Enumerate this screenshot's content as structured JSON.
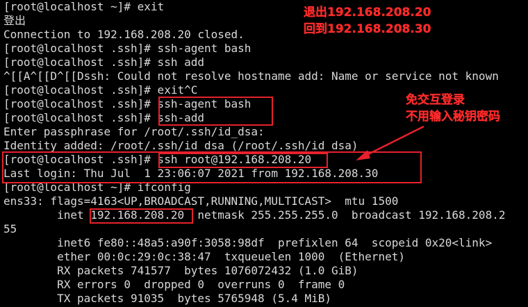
{
  "terminal": {
    "background": "#000000",
    "text_color": "#d9d9d9",
    "lines": [
      "[root@localhost ~]# exit",
      "登出",
      "Connection to 192.168.208.20 closed.",
      "[root@localhost .ssh]# ssh-agent bash",
      "[root@localhost .ssh]# ssh add",
      "^[[A^[[D^[[Dssh: Could not resolve hostname add: Name or service not known",
      "[root@localhost .ssh]# exit^C",
      "[root@localhost .ssh]# ssh-agent bash",
      "[root@localhost .ssh]# ssh-add",
      "Enter passphrase for /root/.ssh/id_dsa:",
      "Identity added: /root/.ssh/id_dsa (/root/.ssh/id_dsa)",
      "[root@localhost .ssh]# ssh root@192.168.208.20",
      "Last login: Thu Jul  1 23:06:07 2021 from 192.168.208.30",
      "[root@localhost ~]# ifconfig",
      "ens33: flags=4163<UP,BROADCAST,RUNNING,MULTICAST>  mtu 1500",
      "        inet 192.168.208.20  netmask 255.255.255.0  broadcast 192.168.208.2",
      "55",
      "        inet6 fe80::48a5:a90f:3058:98df  prefixlen 64  scopeid 0x20<link>",
      "        ether 00:0c:29:0c:38:47  txqueuelen 1000  (Ethernet)",
      "        RX packets 741577  bytes 1076072432 (1.0 GiB)",
      "        RX errors 0  dropped 0  overruns 0  frame 0",
      "        TX packets 91035  bytes 5765948 (5.4 MiB)"
    ]
  },
  "annotations": {
    "color": "#ff2a2a",
    "top_note_line1": "退出192.168.208.20",
    "top_note_line2": "回到192.168.208.30",
    "mid_note_line1": "免交互登录",
    "mid_note_line2": "不用输入秘钥密码"
  }
}
